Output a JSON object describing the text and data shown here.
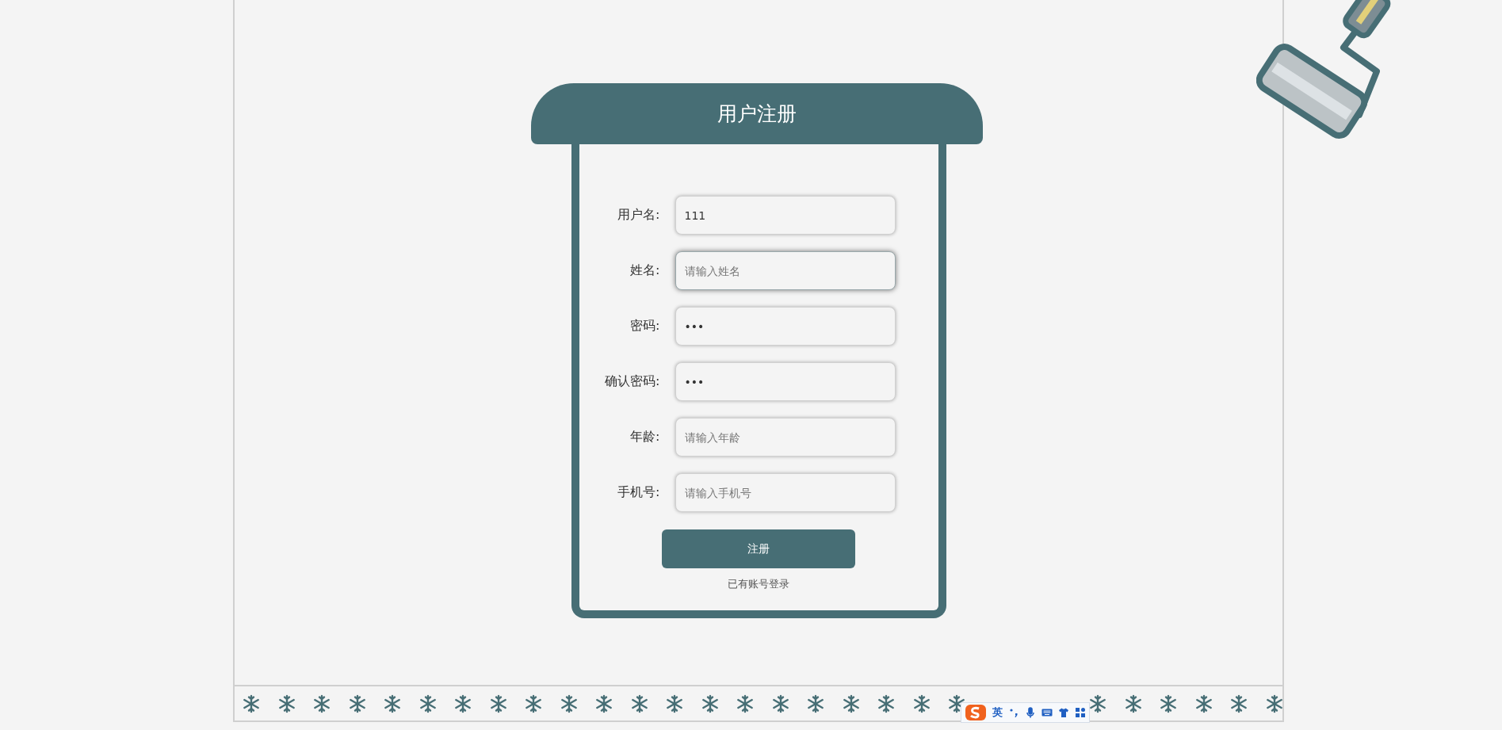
{
  "form": {
    "title": "用户注册",
    "fields": [
      {
        "label": "用户名:",
        "value": "111",
        "focused": false
      },
      {
        "label": "姓名:",
        "placeholder": "请输入姓名",
        "focused": true
      },
      {
        "label": "密码:",
        "value": "•••",
        "focused": false
      },
      {
        "label": "确认密码:",
        "value": "•••",
        "focused": false
      },
      {
        "label": "年龄:",
        "placeholder": "请输入年龄",
        "focused": false
      },
      {
        "label": "手机号:",
        "placeholder": "请输入手机号",
        "focused": false
      }
    ],
    "submit": "注册",
    "login_link": "已有账号登录"
  },
  "ime_toolbar": {
    "mode": "英"
  }
}
